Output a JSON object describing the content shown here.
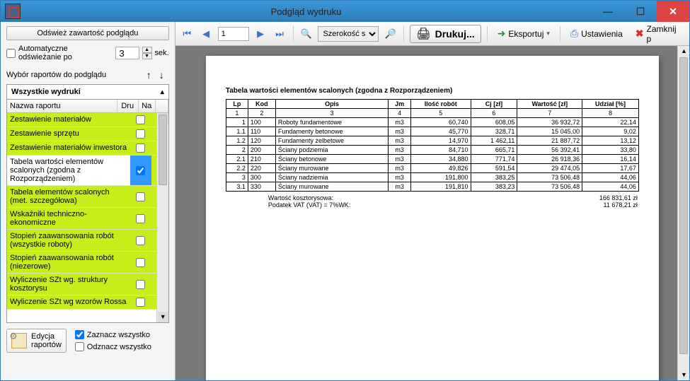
{
  "window": {
    "title": "Podgląd wydruku"
  },
  "left": {
    "refresh": "Odśwież zawartość podglądu",
    "auto_label": "Automatyczne odświeżanie po",
    "auto_value": "3",
    "auto_unit": "sek.",
    "choose_label": "Wybór raportów do podglądu",
    "tab_title": "Wszystkie wydruki",
    "col_name": "Nazwa raportu",
    "col_dr": "Dru",
    "col_na": "Na",
    "rows": [
      {
        "name": "Zestawienie materiałów",
        "checked": false,
        "selected": false
      },
      {
        "name": "Zestawienie sprzętu",
        "checked": false,
        "selected": false
      },
      {
        "name": "Zestawienie materiałów inwestora",
        "checked": false,
        "selected": false
      },
      {
        "name": "Tabela wartości elementów scalonych (zgodna z Rozporządzeniem)",
        "checked": true,
        "selected": true
      },
      {
        "name": "Tabela elementów scalonych (met. szczegółowa)",
        "checked": false,
        "selected": false
      },
      {
        "name": "Wskaźniki techniczno-ekonomiczne",
        "checked": false,
        "selected": false
      },
      {
        "name": "Stopień zaawansowania robót (wszystkie roboty)",
        "checked": false,
        "selected": false
      },
      {
        "name": "Stopień zaawansowania robót (niezerowe)",
        "checked": false,
        "selected": false
      },
      {
        "name": "Wyliczenie SZt wg. struktury kosztorysu",
        "checked": false,
        "selected": false
      },
      {
        "name": "Wyliczenie SZt wg wzorów Rossa",
        "checked": false,
        "selected": false
      }
    ],
    "edit_reports": "Edycja\nraportów",
    "select_all": "Zaznacz wszystko",
    "deselect_all": "Odznacz wszystko"
  },
  "toolbar": {
    "page": "1",
    "zoom_label": "Szerokość s",
    "print": "Drukuj...",
    "export": "Eksportuj",
    "settings": "Ustawienia",
    "close": "Zamknij p"
  },
  "report": {
    "title": "Tabela wartości elementów scalonych (zgodna z Rozporządzeniem)",
    "headers": [
      "Lp",
      "Kod",
      "Opis",
      "Jm",
      "Ilość robót",
      "Cj [zł]",
      "Wartość [zł]",
      "Udział [%]"
    ],
    "colnums": [
      "1",
      "2",
      "3",
      "4",
      "5",
      "6",
      "7",
      "8"
    ],
    "rows": [
      {
        "lp": "1",
        "kod": "100",
        "opis": "Roboty fundamentowe",
        "jm": "m3",
        "ilosc": "60,740",
        "cj": "608,05",
        "wart": "36 932,72",
        "udz": "22,14"
      },
      {
        "lp": "1.1",
        "kod": "110",
        "opis": "Fundamenty betonowe",
        "jm": "m3",
        "ilosc": "45,770",
        "cj": "328,71",
        "wart": "15 045,00",
        "udz": "9,02"
      },
      {
        "lp": "1.2",
        "kod": "120",
        "opis": "Fundamenty żelbetowe",
        "jm": "m3",
        "ilosc": "14,970",
        "cj": "1 462,11",
        "wart": "21 887,72",
        "udz": "13,12"
      },
      {
        "lp": "2",
        "kod": "200",
        "opis": "Ściany podziemia",
        "jm": "m3",
        "ilosc": "84,710",
        "cj": "665,71",
        "wart": "56 392,41",
        "udz": "33,80"
      },
      {
        "lp": "2.1",
        "kod": "210",
        "opis": "Ściany betonowe",
        "jm": "m3",
        "ilosc": "34,880",
        "cj": "771,74",
        "wart": "26 918,36",
        "udz": "16,14"
      },
      {
        "lp": "2.2",
        "kod": "220",
        "opis": "Ściany murowane",
        "jm": "m3",
        "ilosc": "49,826",
        "cj": "591,54",
        "wart": "29 474,05",
        "udz": "17,67"
      },
      {
        "lp": "3",
        "kod": "300",
        "opis": "Ściany nadziemia",
        "jm": "m3",
        "ilosc": "191,800",
        "cj": "383,25",
        "wart": "73 506,48",
        "udz": "44,06"
      },
      {
        "lp": "3.1",
        "kod": "330",
        "opis": "Ściany murowane",
        "jm": "m3",
        "ilosc": "191,810",
        "cj": "383,23",
        "wart": "73 506,48",
        "udz": "44,06"
      }
    ],
    "sum_label1": "Wartość kosztorysowa:",
    "sum_label2": "Podatek VAT (VAT) = 7%WK:",
    "sum_val1": "166 831,61 zł",
    "sum_val2": "11 678,21 zł"
  }
}
